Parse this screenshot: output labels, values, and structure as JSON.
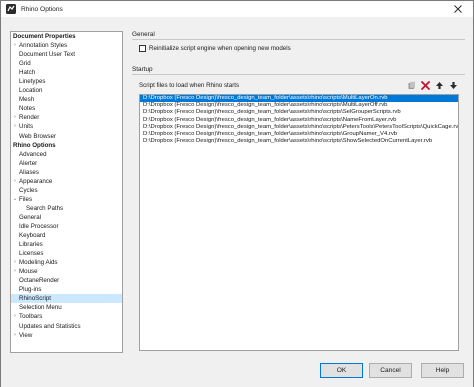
{
  "window": {
    "title": "Rhino Options"
  },
  "tree": [
    {
      "label": "Document Properties",
      "level": 0,
      "header": true,
      "twisty": ""
    },
    {
      "label": "Annotation Styles",
      "level": 1,
      "twisty": "›"
    },
    {
      "label": "Document User Text",
      "level": 1,
      "twisty": ""
    },
    {
      "label": "Grid",
      "level": 1,
      "twisty": ""
    },
    {
      "label": "Hatch",
      "level": 1,
      "twisty": ""
    },
    {
      "label": "Linetypes",
      "level": 1,
      "twisty": ""
    },
    {
      "label": "Location",
      "level": 1,
      "twisty": ""
    },
    {
      "label": "Mesh",
      "level": 1,
      "twisty": ""
    },
    {
      "label": "Notes",
      "level": 1,
      "twisty": ""
    },
    {
      "label": "Render",
      "level": 1,
      "twisty": "›"
    },
    {
      "label": "Units",
      "level": 1,
      "twisty": "›"
    },
    {
      "label": "Web Browser",
      "level": 1,
      "twisty": ""
    },
    {
      "label": "Rhino Options",
      "level": 0,
      "header": true,
      "twisty": ""
    },
    {
      "label": "Advanced",
      "level": 1,
      "twisty": ""
    },
    {
      "label": "Alerter",
      "level": 1,
      "twisty": ""
    },
    {
      "label": "Aliases",
      "level": 1,
      "twisty": ""
    },
    {
      "label": "Appearance",
      "level": 1,
      "twisty": "›"
    },
    {
      "label": "Cycles",
      "level": 1,
      "twisty": ""
    },
    {
      "label": "Files",
      "level": 1,
      "twisty": "⌄"
    },
    {
      "label": "Search Paths",
      "level": 2,
      "twisty": ""
    },
    {
      "label": "General",
      "level": 1,
      "twisty": ""
    },
    {
      "label": "Idle Processor",
      "level": 1,
      "twisty": ""
    },
    {
      "label": "Keyboard",
      "level": 1,
      "twisty": ""
    },
    {
      "label": "Libraries",
      "level": 1,
      "twisty": ""
    },
    {
      "label": "Licenses",
      "level": 1,
      "twisty": ""
    },
    {
      "label": "Modeling Aids",
      "level": 1,
      "twisty": "›"
    },
    {
      "label": "Mouse",
      "level": 1,
      "twisty": "›"
    },
    {
      "label": "OctaneRender",
      "level": 1,
      "twisty": ""
    },
    {
      "label": "Plug-ins",
      "level": 1,
      "twisty": ""
    },
    {
      "label": "RhinoScript",
      "level": 1,
      "twisty": "",
      "selected": true
    },
    {
      "label": "Selection Menu",
      "level": 1,
      "twisty": ""
    },
    {
      "label": "Toolbars",
      "level": 1,
      "twisty": "›"
    },
    {
      "label": "Updates and Statistics",
      "level": 1,
      "twisty": ""
    },
    {
      "label": "View",
      "level": 1,
      "twisty": "›"
    }
  ],
  "general": {
    "section_label": "General",
    "reinitialize_label": "Reinitialize script engine when opening new models",
    "reinitialize_checked": false
  },
  "startup": {
    "section_label": "Startup",
    "list_label": "Script files to load when Rhino starts",
    "files": [
      "D:\\Dropbox (Fresco Design)\\fresco_design_team_folder\\assets\\rhino\\scripts\\MultiLayerOn.rvb",
      "D:\\Dropbox (Fresco Design)\\fresco_design_team_folder\\assets\\rhino\\scripts\\MultiLayerOff.rvb",
      "D:\\Dropbox (Fresco Design)\\fresco_design_team_folder\\assets\\rhino\\scripts\\SelGrouperScripts.rvb",
      "D:\\Dropbox (Fresco Design)\\fresco_design_team_folder\\assets\\rhino\\scripts\\NameFromLayer.rvb",
      "D:\\Dropbox (Fresco Design)\\fresco_design_team_folder\\assets\\rhino\\scripts\\PetersTools\\PetersToolScripts\\QuickCage.rvb",
      "D:\\Dropbox (Fresco Design)\\fresco_design_team_folder\\assets\\rhino\\scripts\\GroupNamer_V4.rvb",
      "D:\\Dropbox (Fresco Design)\\fresco_design_team_folder\\assets\\rhino\\scripts\\ShowSelectedOnCurrentLayer.rvb"
    ],
    "selected_index": 0
  },
  "buttons": {
    "ok": "OK",
    "cancel": "Cancel",
    "help": "Help"
  },
  "icons": {
    "add": "add-file-icon",
    "remove": "delete-x-icon",
    "up": "arrow-up-icon",
    "down": "arrow-down-icon"
  },
  "colors": {
    "selection": "#0078d7",
    "tree_selection": "#cce8ff",
    "delete_red": "#c8102e"
  }
}
